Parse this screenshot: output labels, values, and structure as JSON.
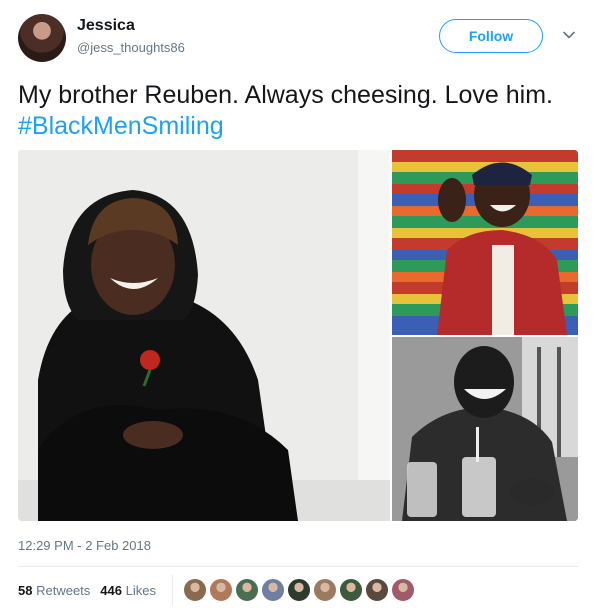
{
  "author": {
    "name": "Jessica",
    "handle": "@jess_thoughts86"
  },
  "follow_label": "Follow",
  "tweet": {
    "text": "My brother Reuben. Always cheesing. Love him. ",
    "hashtag": "#BlackMenSmiling"
  },
  "timestamp": "12:29 PM - 2 Feb 2018",
  "stats": {
    "retweets_count": "58",
    "retweets_label": "Retweets",
    "likes_count": "446",
    "likes_label": "Likes"
  },
  "likers": [
    {
      "color": "#8a6a4e"
    },
    {
      "color": "#b07a5a"
    },
    {
      "color": "#4a6f50"
    },
    {
      "color": "#6f7fa2"
    },
    {
      "color": "#2e3a2e"
    },
    {
      "color": "#9c7a62"
    },
    {
      "color": "#3e5a3a"
    },
    {
      "color": "#5a4a3e"
    },
    {
      "color": "#a05a6a"
    }
  ],
  "colors": {
    "accent": "#1da1f2",
    "muted": "#657786",
    "text": "#14171a"
  }
}
